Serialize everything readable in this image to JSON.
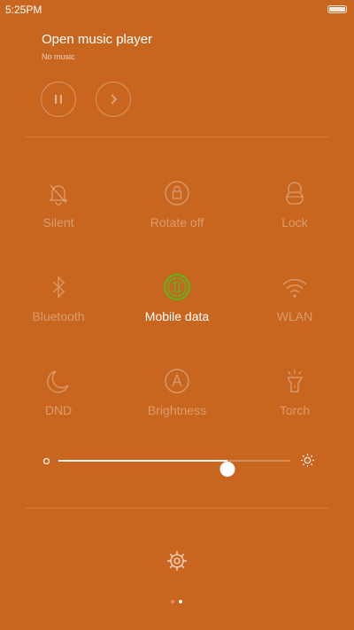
{
  "status_bar": {
    "time": "5:25PM",
    "battery_icon": "battery-icon"
  },
  "music": {
    "title": "Open music player",
    "subtitle": "No music",
    "pause_icon": "pause-icon",
    "next_icon": "next-icon"
  },
  "toggles": [
    {
      "label": "Silent",
      "icon": "bell-off-icon",
      "active": false
    },
    {
      "label": "Rotate off",
      "icon": "rotation-lock-icon",
      "active": false
    },
    {
      "label": "Lock",
      "icon": "lock-icon",
      "active": false
    },
    {
      "label": "Bluetooth",
      "icon": "bluetooth-icon",
      "active": false
    },
    {
      "label": "Mobile data",
      "icon": "mobile-data-icon",
      "active": true
    },
    {
      "label": "WLAN",
      "icon": "wifi-icon",
      "active": false
    },
    {
      "label": "DND",
      "icon": "moon-icon",
      "active": false
    },
    {
      "label": "Brightness",
      "icon": "auto-brightness-icon",
      "active": false
    },
    {
      "label": "Torch",
      "icon": "flashlight-icon",
      "active": false
    }
  ],
  "brightness": {
    "level": 0.73,
    "min_icon": "brightness-low-icon",
    "max_icon": "brightness-high-icon"
  },
  "settings_icon": "gear-icon",
  "pages": {
    "count": 2,
    "active_index": 1
  },
  "colors": {
    "background": "#c8661f",
    "active_accent": "#5fb322",
    "active_dot": "#ffffff",
    "inactive_dot": "#ee8a66"
  }
}
